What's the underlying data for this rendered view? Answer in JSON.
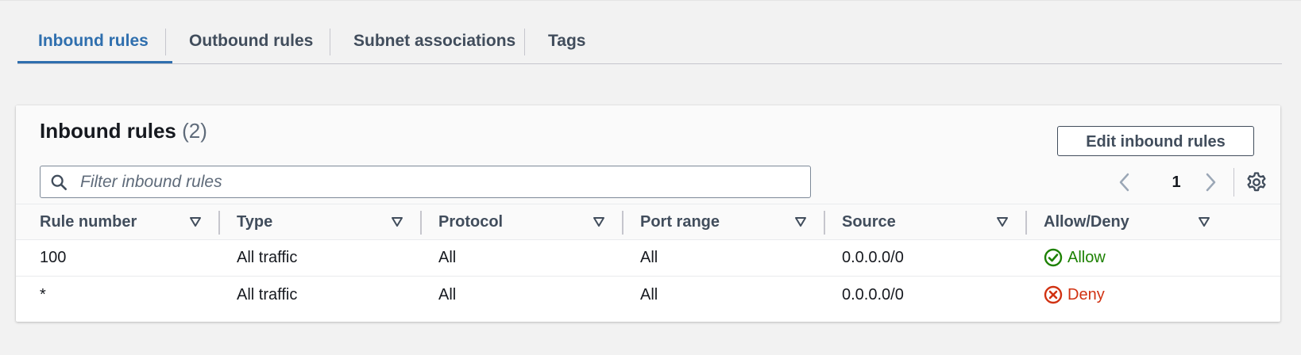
{
  "tabs": [
    {
      "label": "Inbound rules",
      "active": true
    },
    {
      "label": "Outbound rules",
      "active": false
    },
    {
      "label": "Subnet associations",
      "active": false
    },
    {
      "label": "Tags",
      "active": false
    }
  ],
  "panel": {
    "title": "Inbound rules",
    "count": "(2)",
    "edit_button": "Edit inbound rules",
    "filter_placeholder": "Filter inbound rules",
    "filter_value": "",
    "page_number": "1"
  },
  "table": {
    "columns": [
      "Rule number",
      "Type",
      "Protocol",
      "Port range",
      "Source",
      "Allow/Deny"
    ],
    "rows": [
      {
        "rule_number": "100",
        "type": "All traffic",
        "protocol": "All",
        "port_range": "All",
        "source": "0.0.0.0/0",
        "action": "Allow",
        "action_status": "success"
      },
      {
        "rule_number": "*",
        "type": "All traffic",
        "protocol": "All",
        "port_range": "All",
        "source": "0.0.0.0/0",
        "action": "Deny",
        "action_status": "error"
      }
    ]
  },
  "icons": {
    "filter": "search-icon",
    "prev": "chevron-left-icon",
    "next": "chevron-right-icon",
    "settings": "gear-icon",
    "sort": "caret-down-icon",
    "allow": "check-circle-icon",
    "deny": "x-circle-icon"
  },
  "colors": {
    "active_tab": "#2f6fae",
    "allow": "#1d8102",
    "deny": "#d13212",
    "page_bg": "#f2f2f2"
  }
}
